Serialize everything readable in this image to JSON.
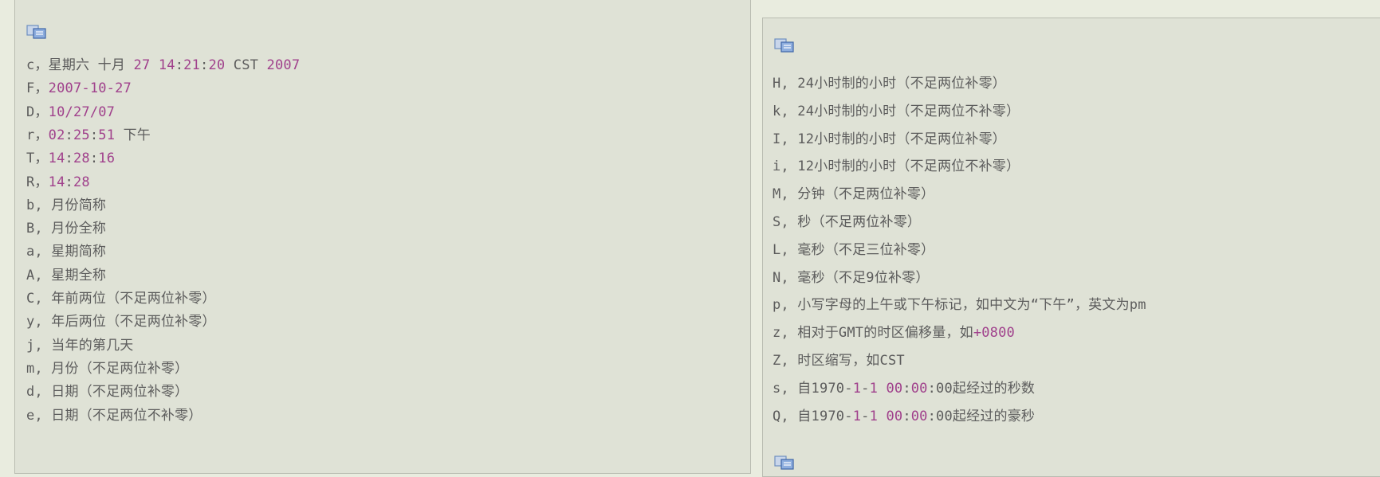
{
  "colors": {
    "text": "#5c5c5c",
    "highlight": "#a0418c",
    "panel_bg": "#dfe2d6",
    "border": "#b9bcb1"
  },
  "icons": {
    "copy": "copy-icon"
  },
  "left": {
    "lines": [
      {
        "segs": [
          {
            "t": "c，星期六 十月 ",
            "h": false
          },
          {
            "t": "27 14",
            "h": true
          },
          {
            "t": ":",
            "h": false
          },
          {
            "t": "21",
            "h": true
          },
          {
            "t": ":",
            "h": false
          },
          {
            "t": "20",
            "h": true
          },
          {
            "t": " CST ",
            "h": false
          },
          {
            "t": "2007",
            "h": true
          }
        ]
      },
      {
        "segs": [
          {
            "t": "F，",
            "h": false
          },
          {
            "t": "2007-10-27",
            "h": true
          }
        ]
      },
      {
        "segs": [
          {
            "t": "D，",
            "h": false
          },
          {
            "t": "10/27/07",
            "h": true
          }
        ]
      },
      {
        "segs": [
          {
            "t": "r，",
            "h": false
          },
          {
            "t": "02",
            "h": true
          },
          {
            "t": ":",
            "h": false
          },
          {
            "t": "25",
            "h": true
          },
          {
            "t": ":",
            "h": false
          },
          {
            "t": "51",
            "h": true
          },
          {
            "t": " 下午",
            "h": false
          }
        ]
      },
      {
        "segs": [
          {
            "t": "T，",
            "h": false
          },
          {
            "t": "14",
            "h": true
          },
          {
            "t": ":",
            "h": false
          },
          {
            "t": "28",
            "h": true
          },
          {
            "t": ":",
            "h": false
          },
          {
            "t": "16",
            "h": true
          }
        ]
      },
      {
        "segs": [
          {
            "t": "R，",
            "h": false
          },
          {
            "t": "14",
            "h": true
          },
          {
            "t": ":",
            "h": false
          },
          {
            "t": "28",
            "h": true
          }
        ]
      },
      {
        "segs": [
          {
            "t": "b, 月份简称",
            "h": false
          }
        ]
      },
      {
        "segs": [
          {
            "t": "B, 月份全称",
            "h": false
          }
        ]
      },
      {
        "segs": [
          {
            "t": "a, 星期简称",
            "h": false
          }
        ]
      },
      {
        "segs": [
          {
            "t": "A, 星期全称",
            "h": false
          }
        ]
      },
      {
        "segs": [
          {
            "t": "C, 年前两位（不足两位补零）",
            "h": false
          }
        ]
      },
      {
        "segs": [
          {
            "t": "y, 年后两位（不足两位补零）",
            "h": false
          }
        ]
      },
      {
        "segs": [
          {
            "t": "j, 当年的第几天",
            "h": false
          }
        ]
      },
      {
        "segs": [
          {
            "t": "m, 月份（不足两位补零）",
            "h": false
          }
        ]
      },
      {
        "segs": [
          {
            "t": "d, 日期（不足两位补零）",
            "h": false
          }
        ]
      },
      {
        "segs": [
          {
            "t": "e, 日期（不足两位不补零）",
            "h": false
          }
        ]
      }
    ]
  },
  "right": {
    "lines": [
      {
        "segs": [
          {
            "t": "H, 24小时制的小时（不足两位补零）",
            "h": false
          }
        ]
      },
      {
        "segs": [
          {
            "t": "k, 24小时制的小时（不足两位不补零）",
            "h": false
          }
        ]
      },
      {
        "segs": [
          {
            "t": "I, 12小时制的小时（不足两位补零）",
            "h": false
          }
        ]
      },
      {
        "segs": [
          {
            "t": "i, 12小时制的小时（不足两位不补零）",
            "h": false
          }
        ]
      },
      {
        "segs": [
          {
            "t": "M, 分钟（不足两位补零）",
            "h": false
          }
        ]
      },
      {
        "segs": [
          {
            "t": "S, 秒（不足两位补零）",
            "h": false
          }
        ]
      },
      {
        "segs": [
          {
            "t": "L, 毫秒（不足三位补零）",
            "h": false
          }
        ]
      },
      {
        "segs": [
          {
            "t": "N, 毫秒（不足9位补零）",
            "h": false
          }
        ]
      },
      {
        "segs": [
          {
            "t": "p, 小写字母的上午或下午标记，如中文为“下午”，英文为pm",
            "h": false
          }
        ]
      },
      {
        "segs": [
          {
            "t": "z, 相对于GMT的时区偏移量，如",
            "h": false
          },
          {
            "t": "+0800",
            "h": true
          }
        ]
      },
      {
        "segs": [
          {
            "t": "Z, 时区缩写，如CST",
            "h": false
          }
        ]
      },
      {
        "segs": [
          {
            "t": "s, 自1970-",
            "h": false
          },
          {
            "t": "1",
            "h": true
          },
          {
            "t": "-",
            "h": false
          },
          {
            "t": "1",
            "h": true
          },
          {
            "t": " ",
            "h": false
          },
          {
            "t": "00",
            "h": true
          },
          {
            "t": ":",
            "h": false
          },
          {
            "t": "00",
            "h": true
          },
          {
            "t": ":00起经过的秒数",
            "h": false
          }
        ]
      },
      {
        "segs": [
          {
            "t": "Q, 自1970-",
            "h": false
          },
          {
            "t": "1",
            "h": true
          },
          {
            "t": "-",
            "h": false
          },
          {
            "t": "1",
            "h": true
          },
          {
            "t": " ",
            "h": false
          },
          {
            "t": "00",
            "h": true
          },
          {
            "t": ":",
            "h": false
          },
          {
            "t": "00",
            "h": true
          },
          {
            "t": ":00起经过的豪秒",
            "h": false
          }
        ]
      }
    ]
  }
}
